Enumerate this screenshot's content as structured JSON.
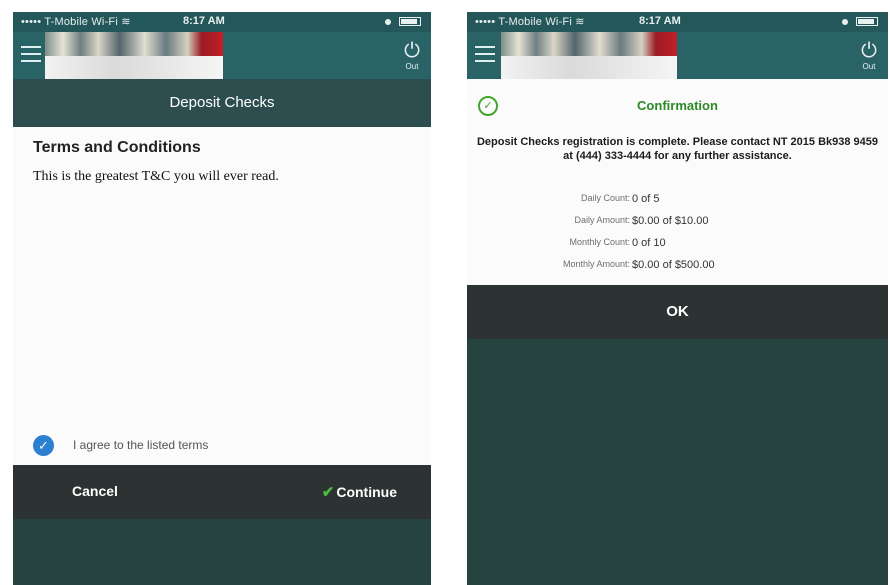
{
  "status_bar": {
    "carrier": "••••• T-Mobile Wi-Fi ≋",
    "time": "8:17 AM"
  },
  "header": {
    "logout_label": "Out",
    "icons": [
      "menu-icon",
      "power-icon"
    ]
  },
  "left_screen": {
    "title": "Deposit Checks",
    "terms_heading": "Terms and Conditions",
    "terms_body": "This is the greatest T&C you will ever read.",
    "agree_label": "I agree to the listed terms",
    "agree_checked": true,
    "cancel_label": "Cancel",
    "continue_label": "Continue"
  },
  "right_screen": {
    "confirm_title": "Confirmation",
    "message": "Deposit Checks registration is complete. Please contact NT 2015 Bk938 9459 at (444) 333-4444 for any further assistance.",
    "limits": [
      {
        "label": "Daily Count:",
        "value": "0 of 5"
      },
      {
        "label": "Daily Amount:",
        "value": "$0.00 of $10.00"
      },
      {
        "label": "Monthly Count:",
        "value": "0 of 10"
      },
      {
        "label": "Monthly Amount:",
        "value": "$0.00 of $500.00"
      }
    ],
    "ok_label": "OK"
  },
  "colors": {
    "header_teal": "#2a6366",
    "title_bar": "#2e4d4f",
    "action_bar": "#2d3232",
    "checkbox_blue": "#2d7fd0",
    "success_green": "#43a62a"
  }
}
